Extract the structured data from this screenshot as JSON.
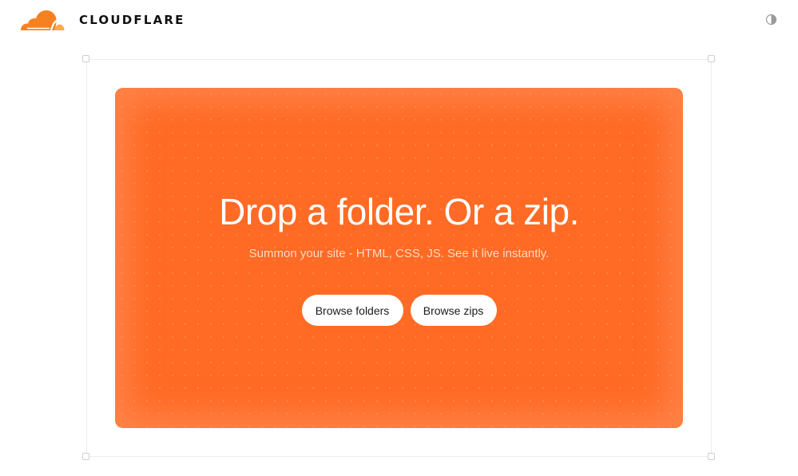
{
  "header": {
    "brand": "CLOUDFLARE",
    "logo_icon": "cloudflare-cloud-icon",
    "theme_toggle_icon": "half-circle-contrast-icon"
  },
  "dropzone": {
    "title": "Drop a folder. Or a zip.",
    "subtitle": "Summon your site - HTML, CSS, JS. See it live instantly.",
    "browse_folders_label": "Browse folders",
    "browse_zips_label": "Browse zips"
  },
  "colors": {
    "accent": "#ff6a24",
    "logo_orange": "#f6821f",
    "logo_yellow": "#fbad41",
    "text_dark": "#111111"
  }
}
